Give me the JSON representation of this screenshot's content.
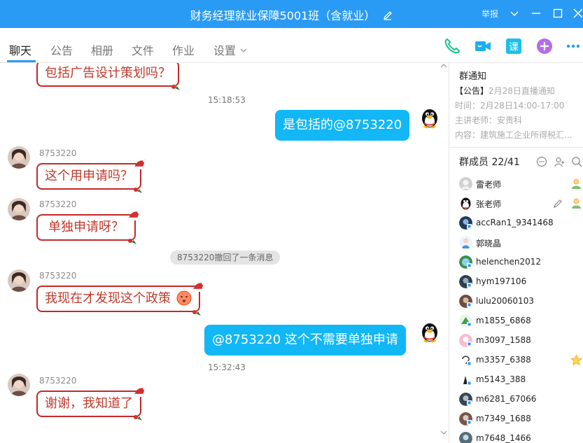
{
  "window": {
    "title": "财务经理就业保障5001班（含就业）",
    "report_label": "举报"
  },
  "tabs": [
    "聊天",
    "公告",
    "相册",
    "文件",
    "作业",
    "设置"
  ],
  "toolbar_icons": [
    "phone-icon",
    "video-icon",
    "class-icon",
    "add-icon",
    "more-icon"
  ],
  "messages": {
    "m0": {
      "text": "包括广告设计策划吗？"
    },
    "t1": "15:18:53",
    "m1": {
      "text": "是包括的@8753220"
    },
    "m2": {
      "sender": "8753220",
      "text": "这个用申请吗？"
    },
    "m3": {
      "sender": "8753220",
      "text": "单独申请呀？"
    },
    "sys": "8753220撤回了一条消息",
    "m4": {
      "sender": "8753220",
      "text": "我现在才发现这个政策"
    },
    "m5": {
      "text": "@8753220 这个不需要单独申请"
    },
    "t2": "15:32:43",
    "m6": {
      "sender": "8753220",
      "text": "谢谢，我知道了"
    }
  },
  "notice": {
    "title": "群通知",
    "tag": "【公告】",
    "headline": "2月28日直播通知",
    "time": "时间：2月28日14:00-17:00",
    "teacher": "主讲老师：安贵科",
    "content": "内容：建筑施工企业所得税汇..."
  },
  "members": {
    "title": "群成员 22/41",
    "list": [
      {
        "name": "雷老师"
      },
      {
        "name": "张老师"
      },
      {
        "name": "accRan1_9341468"
      },
      {
        "name": "郭晓晶"
      },
      {
        "name": "helenchen2012"
      },
      {
        "name": "hym197106"
      },
      {
        "name": "lulu20060103"
      },
      {
        "name": "m1855_6868"
      },
      {
        "name": "m3097_1588"
      },
      {
        "name": "m3357_6388"
      },
      {
        "name": "m5143_388"
      },
      {
        "name": "m6281_67066"
      },
      {
        "name": "m7349_1688"
      },
      {
        "name": "m7648_1466"
      }
    ]
  },
  "colors": {
    "titlebar": "#2a9bf5",
    "outgoing_bubble": "#12b7f5",
    "incoming_border": "#c62828",
    "incoming_text": "#c0392b"
  }
}
